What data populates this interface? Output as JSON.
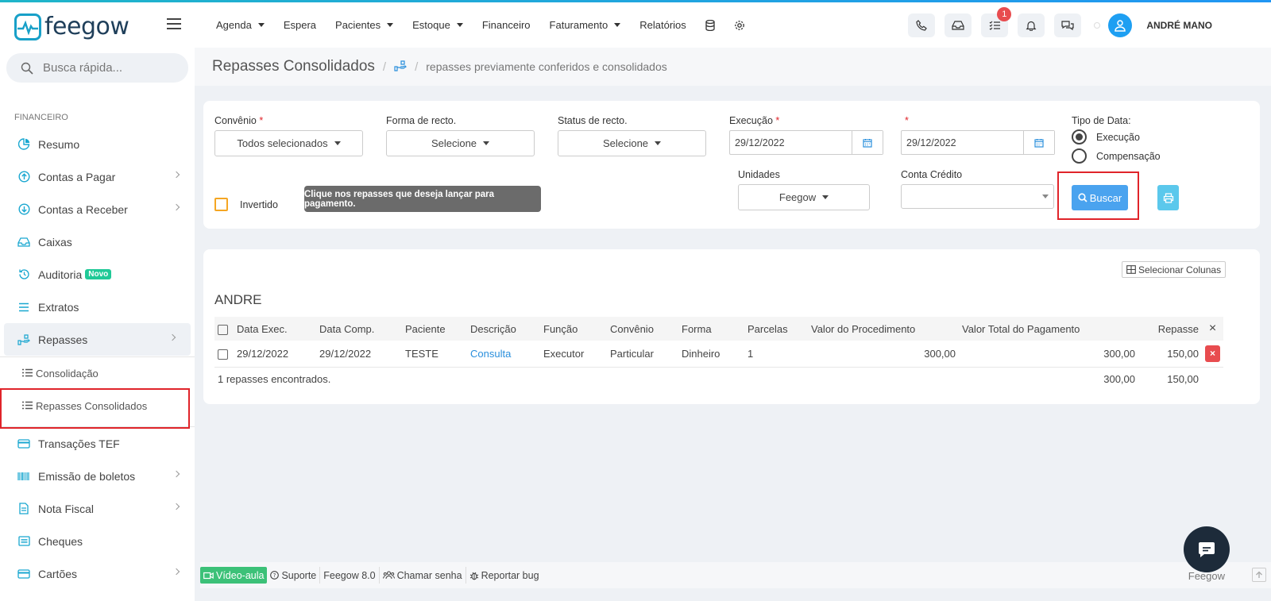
{
  "app": {
    "brand": "feegow",
    "user_name": "ANDRÉ MANO",
    "notification_count": "1"
  },
  "topnav": {
    "items": [
      {
        "label": "Agenda",
        "dropdown": true
      },
      {
        "label": "Espera",
        "dropdown": false
      },
      {
        "label": "Pacientes",
        "dropdown": true
      },
      {
        "label": "Estoque",
        "dropdown": true
      },
      {
        "label": "Financeiro",
        "dropdown": false
      },
      {
        "label": "Faturamento",
        "dropdown": true
      },
      {
        "label": "Relatórios",
        "dropdown": false
      }
    ]
  },
  "sidebar": {
    "search_placeholder": "Busca rápida...",
    "section_title": "FINANCEIRO",
    "items": [
      {
        "label": "Resumo"
      },
      {
        "label": "Contas a Pagar"
      },
      {
        "label": "Contas a Receber"
      },
      {
        "label": "Caixas"
      },
      {
        "label": "Auditoria",
        "badge": "Novo"
      },
      {
        "label": "Extratos"
      },
      {
        "label": "Repasses"
      },
      {
        "label": "Transações TEF"
      },
      {
        "label": "Emissão de boletos"
      },
      {
        "label": "Nota Fiscal"
      },
      {
        "label": "Cheques"
      },
      {
        "label": "Cartões"
      }
    ],
    "subitems": [
      {
        "label": "Consolidação"
      },
      {
        "label": "Repasses Consolidados"
      }
    ]
  },
  "page": {
    "title": "Repasses Consolidados",
    "breadcrumb_sep": "/",
    "breadcrumb": "repasses previamente conferidos e consolidados"
  },
  "filters": {
    "convenio": {
      "label": "Convênio",
      "required": "*",
      "value": "Todos selecionados"
    },
    "forma": {
      "label": "Forma de recto.",
      "value": "Selecione"
    },
    "status": {
      "label": "Status de recto.",
      "value": "Selecione"
    },
    "execucao": {
      "label": "Execução",
      "required": "*",
      "value": "29/12/2022"
    },
    "execucao_fim": {
      "required": "*",
      "value": "29/12/2022"
    },
    "tipo_data": {
      "label": "Tipo de Data:",
      "options": [
        "Execução",
        "Compensação"
      ],
      "selected": "Execução"
    },
    "unidades": {
      "label": "Unidades",
      "value": "Feegow"
    },
    "conta_credito": {
      "label": "Conta Crédito",
      "value": ""
    },
    "invertido_label": "Invertido",
    "tooltip": "Clique nos repasses que deseja lançar para pagamento.",
    "buscar_label": "Buscar"
  },
  "results": {
    "select_columns_label": "Selecionar Colunas",
    "group_name": "ANDRE",
    "close_symbol": "×",
    "columns": [
      "Data Exec.",
      "Data Comp.",
      "Paciente",
      "Descrição",
      "Função",
      "Convênio",
      "Forma",
      "Parcelas",
      "Valor do Procedimento",
      "Valor Total do Pagamento",
      "Repasse"
    ],
    "rows": [
      {
        "data_exec": "29/12/2022",
        "data_comp": "29/12/2022",
        "paciente": "TESTE",
        "descricao": "Consulta",
        "funcao": "Executor",
        "convenio": "Particular",
        "forma": "Dinheiro",
        "parcelas": "1",
        "valor_procedimento": "300,00",
        "valor_total": "300,00",
        "repasse": "150,00"
      }
    ],
    "footer": {
      "count_text": "1 repasses encontrados.",
      "total_pagamento": "300,00",
      "total_repasse": "150,00"
    }
  },
  "footer": {
    "items": [
      "Vídeo-aula",
      "Suporte",
      "Feegow 8.0",
      "Chamar senha",
      "Reportar bug"
    ],
    "brand": "Feegow"
  }
}
